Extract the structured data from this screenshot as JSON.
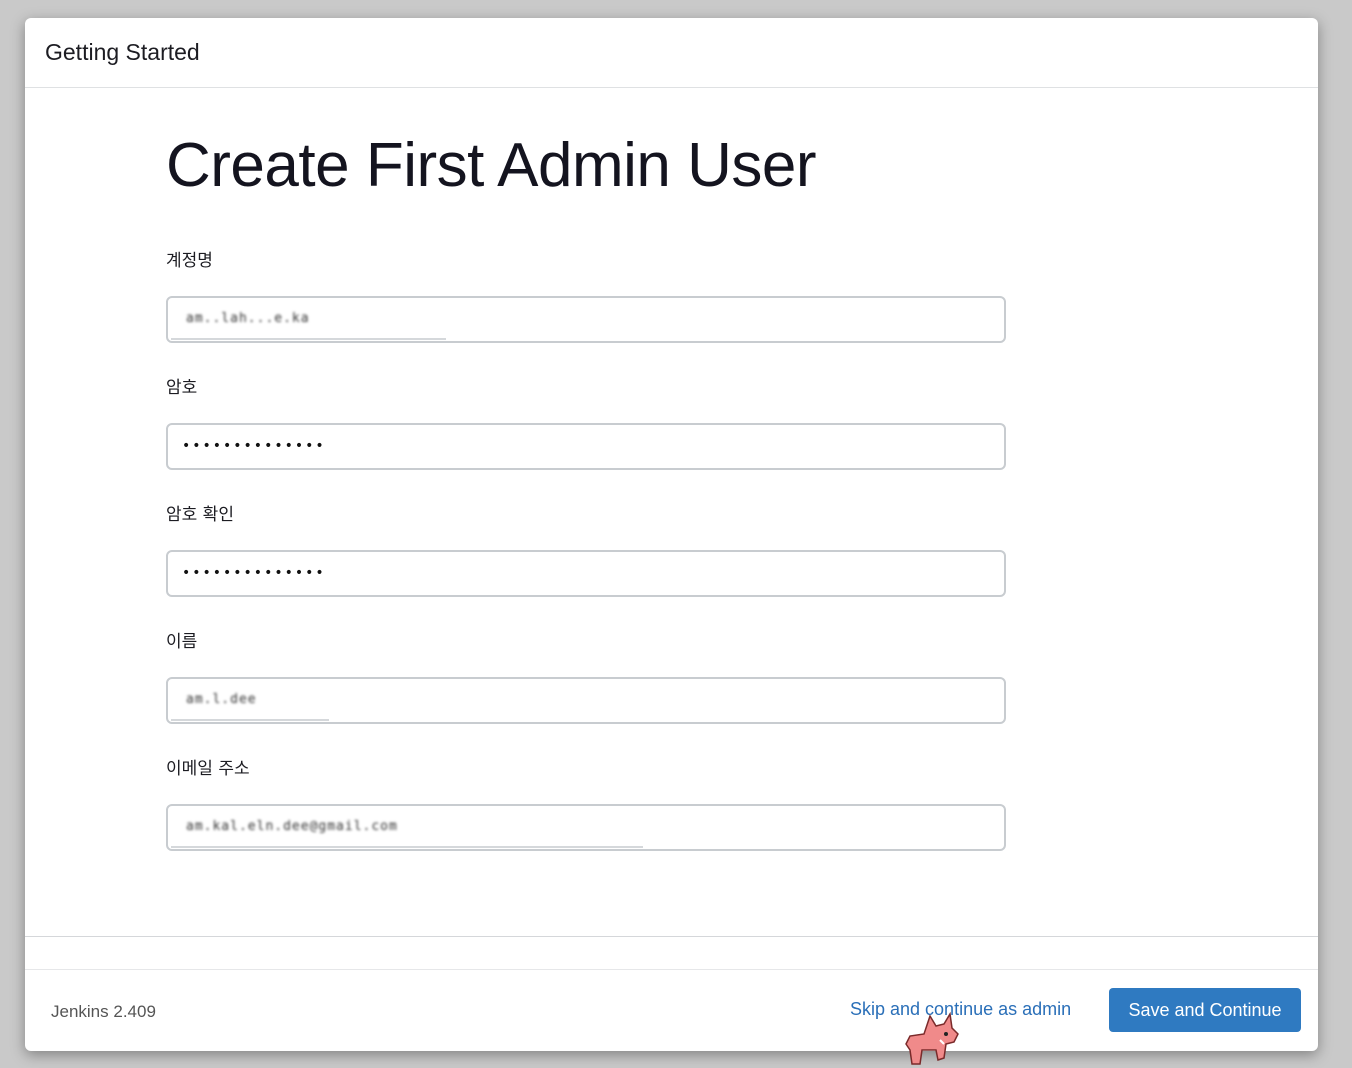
{
  "header": {
    "title": "Getting Started"
  },
  "page": {
    "title": "Create First Admin User"
  },
  "form": {
    "fields": [
      {
        "label": "계정명",
        "value": "am..lah...e.ka",
        "type": "text"
      },
      {
        "label": "암호",
        "value": "••••••••••••••",
        "type": "password"
      },
      {
        "label": "암호 확인",
        "value": "••••••••••••••",
        "type": "password"
      },
      {
        "label": "이름",
        "value": "am.l.dee",
        "type": "text"
      },
      {
        "label": "이메일 주소",
        "value": "am.kal.eln.dee@gmail.com",
        "type": "email"
      }
    ]
  },
  "footer": {
    "version": "Jenkins 2.409",
    "skip_label": "Skip and continue as admin",
    "save_label": "Save and Continue"
  },
  "colors": {
    "accent": "#2f7ac1",
    "link": "#2a6fb8"
  }
}
